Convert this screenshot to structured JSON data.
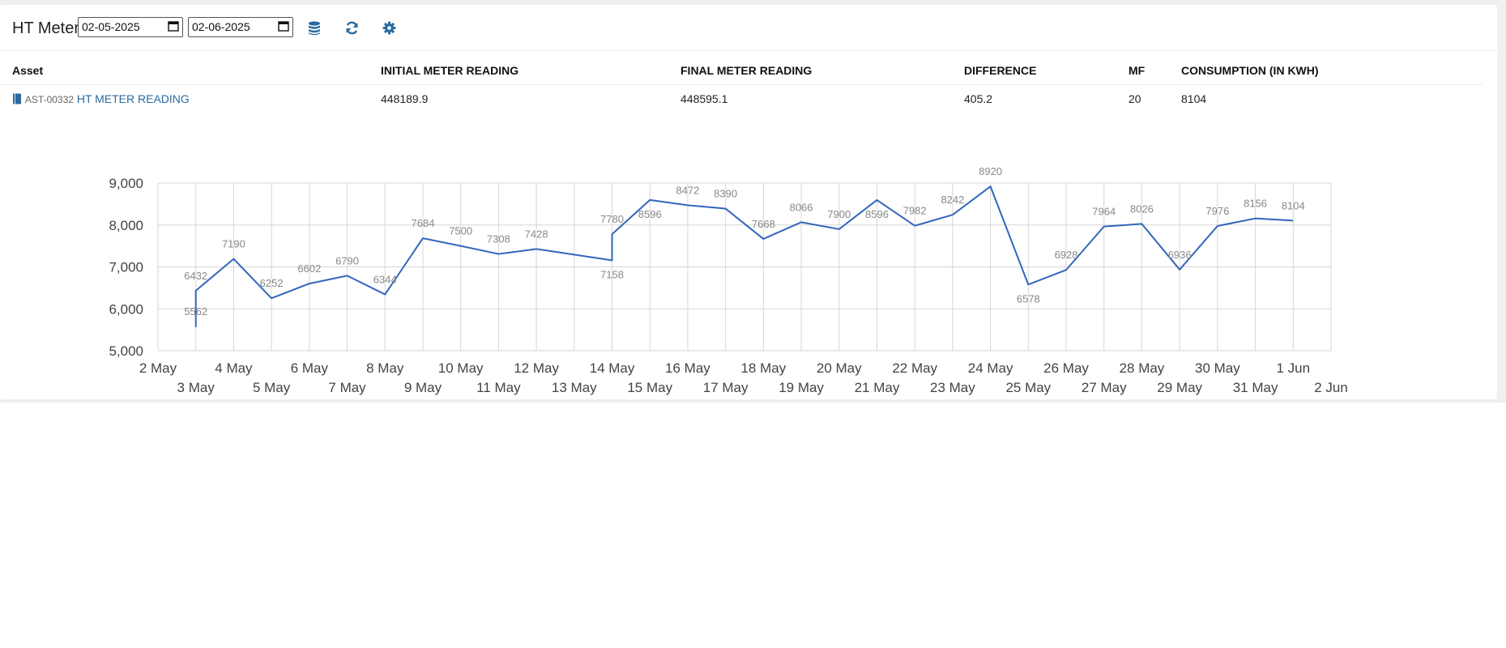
{
  "toolbar": {
    "title": "HT Meter",
    "from_date": "02-05-2025",
    "to_date": "02-06-2025",
    "accent": "#2a6a9f"
  },
  "table": {
    "columns": [
      "Asset",
      "INITIAL METER READING",
      "FINAL METER READING",
      "DIFFERENCE",
      "MF",
      "CONSUMPTION (IN KWH)"
    ],
    "rows": [
      {
        "asset_code": "AST-00332",
        "asset_name": "HT METER READING",
        "initial": "448189.9",
        "final": "448595.1",
        "difference": "405.2",
        "mf": "20",
        "consumption": "8104"
      }
    ]
  },
  "chart_data": {
    "type": "line",
    "color": "#3366bb",
    "title": "",
    "xlabel": "",
    "ylabel": "",
    "ylim": [
      5000,
      9000
    ],
    "y_ticks": [
      "9,000",
      "8,000",
      "7,000",
      "6,000",
      "5,000"
    ],
    "x_tick_labels": [
      "2 May",
      "3 May",
      "4 May",
      "5 May",
      "6 May",
      "7 May",
      "8 May",
      "9 May",
      "10 May",
      "11 May",
      "12 May",
      "13 May",
      "14 May",
      "15 May",
      "16 May",
      "17 May",
      "18 May",
      "19 May",
      "20 May",
      "21 May",
      "22 May",
      "23 May",
      "24 May",
      "25 May",
      "26 May",
      "27 May",
      "28 May",
      "29 May",
      "30 May",
      "31 May",
      "1 Jun",
      "2 Jun"
    ],
    "grid": true,
    "points": [
      {
        "day": 1,
        "value": 5562
      },
      {
        "day": 1,
        "value": 6432
      },
      {
        "day": 2,
        "value": 7190
      },
      {
        "day": 3,
        "value": 6252
      },
      {
        "day": 4,
        "value": 6602
      },
      {
        "day": 5,
        "value": 6790
      },
      {
        "day": 6,
        "value": 6344
      },
      {
        "day": 7,
        "value": 7684
      },
      {
        "day": 8,
        "value": 7500
      },
      {
        "day": 9,
        "value": 7308
      },
      {
        "day": 10,
        "value": 7428
      },
      {
        "day": 12,
        "value": 7158
      },
      {
        "day": 12,
        "value": 7780
      },
      {
        "day": 13,
        "value": 8596
      },
      {
        "day": 14,
        "value": 8472
      },
      {
        "day": 15,
        "value": 8390
      },
      {
        "day": 16,
        "value": 7668
      },
      {
        "day": 17,
        "value": 8066
      },
      {
        "day": 18,
        "value": 7900
      },
      {
        "day": 19,
        "value": 8596
      },
      {
        "day": 20,
        "value": 7982
      },
      {
        "day": 21,
        "value": 8242
      },
      {
        "day": 22,
        "value": 8920
      },
      {
        "day": 23,
        "value": 6578
      },
      {
        "day": 24,
        "value": 6928
      },
      {
        "day": 25,
        "value": 7964
      },
      {
        "day": 26,
        "value": 8026
      },
      {
        "day": 27,
        "value": 6936
      },
      {
        "day": 28,
        "value": 7976
      },
      {
        "day": 29,
        "value": 8156
      },
      {
        "day": 30,
        "value": 8104
      }
    ]
  }
}
